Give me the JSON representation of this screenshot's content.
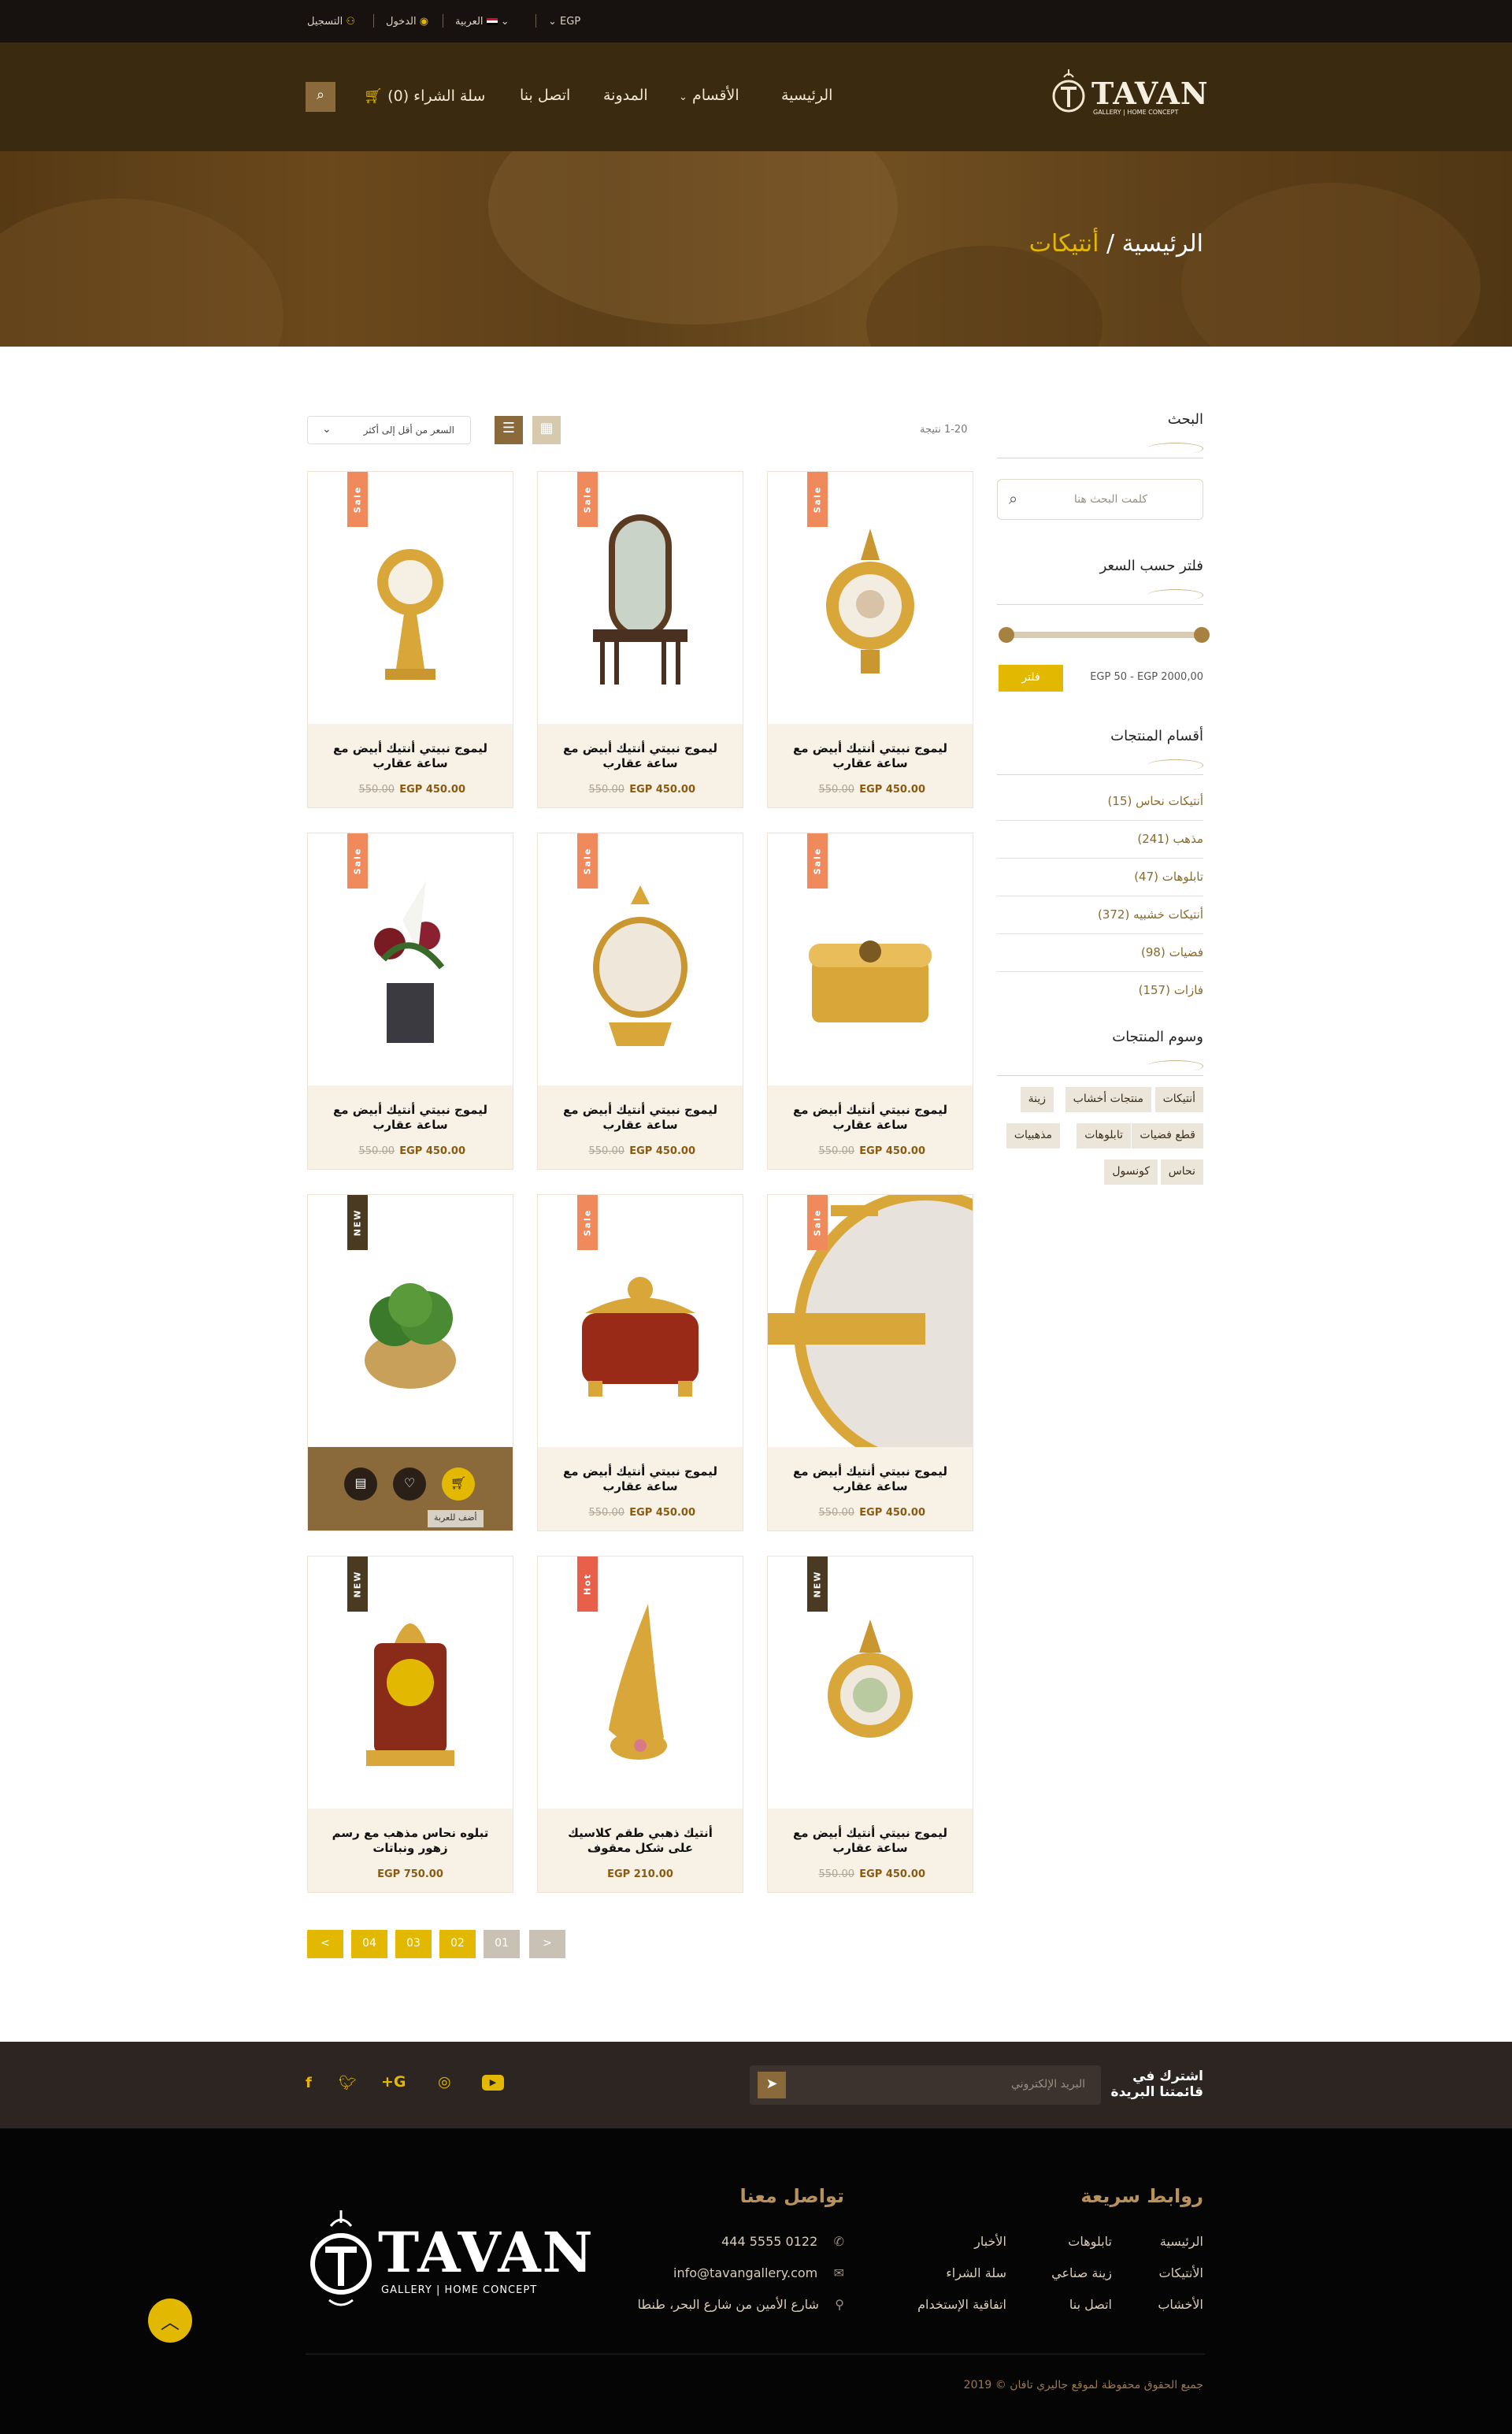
{
  "topbar": {
    "currency": "EGP",
    "language": "العربية",
    "login": "الدخول",
    "register": "التسجيل"
  },
  "brand": {
    "name": "TAVAN",
    "tagline": "GALLERY | HOME CONCEPT"
  },
  "nav": {
    "items": [
      "الرئيسية",
      "الأقسام",
      "المدونة",
      "اتصل بنا"
    ],
    "cart": "سلة الشراء (0)"
  },
  "breadcrumb": {
    "home": "الرئيسية /",
    "current": "أنتيكات"
  },
  "toolbar": {
    "results": "1-20 نتيجة",
    "sort": "السعر من أقل إلى أكثر"
  },
  "sidebar": {
    "search_title": "البحث",
    "search_placeholder": "كلمت البحث هنا",
    "price_title": "فلتر حسب السعر",
    "price_range": "EGP 50  -  EGP 2000,00",
    "filter_button": "فلتر",
    "price_min": 50,
    "price_max": 2000,
    "categories_title": "أقسام المنتجات",
    "categories": [
      "أنتيكات نحاس (15)",
      "مذهب (241)",
      "تابلوهات (47)",
      "أنتيكات خشبيه (372)",
      "فضيات (98)",
      "فازات (157)"
    ],
    "tags_title": "وسوم المنتجات",
    "tags": [
      "أنتيكات",
      "منتجات أخشاب",
      "زينة",
      "قطع فضيات",
      "تابلوهات",
      "مذهبيات",
      "نحاس",
      "كونسول"
    ]
  },
  "products": [
    {
      "name": "ليموج نبيتي أنتيك أبيض مع ساعة عقارب",
      "price": "EGP 450.00",
      "old": "550.00",
      "badge": "Sale"
    },
    {
      "name": "ليموج نبيتي أنتيك أبيض مع ساعة عقارب",
      "price": "EGP 450.00",
      "old": "550.00",
      "badge": "Sale"
    },
    {
      "name": "ليموج نبيتي أنتيك أبيض مع ساعة عقارب",
      "price": "EGP 450.00",
      "old": "550.00",
      "badge": "Sale"
    },
    {
      "name": "ليموج نبيتي أنتيك أبيض مع ساعة عقارب",
      "price": "EGP 450.00",
      "old": "550.00",
      "badge": "Sale"
    },
    {
      "name": "ليموج نبيتي أنتيك أبيض مع ساعة عقارب",
      "price": "EGP 450.00",
      "old": "550.00",
      "badge": "Sale"
    },
    {
      "name": "ليموج نبيتي أنتيك أبيض مع ساعة عقارب",
      "price": "EGP 450.00",
      "old": "550.00",
      "badge": "Sale"
    },
    {
      "name": "ليموج نبيتي أنتيك أبيض مع ساعة عقارب",
      "price": "EGP 450.00",
      "old": "550.00",
      "badge": "Sale"
    },
    {
      "name": "ليموج نبيتي أنتيك أبيض مع ساعة عقارب",
      "price": "EGP 450.00",
      "old": "550.00",
      "badge": "Sale"
    },
    {
      "name": "",
      "price": "",
      "old": "",
      "badge": "NEW",
      "hover_tooltip": "أضف للعربة"
    },
    {
      "name": "ليموج نبيتي أنتيك أبيض مع ساعة عقارب",
      "price": "EGP 450.00",
      "old": "550.00",
      "badge": "NEW"
    },
    {
      "name": "أنتيك ذهبي طقم كلاسيك على شكل معقوف",
      "price": "EGP 210.00",
      "old": "",
      "badge": "Hot"
    },
    {
      "name": "تبلوه نحاس مذهب مع رسم زهور ونباتات",
      "price": "EGP 750.00",
      "old": "",
      "badge": "NEW"
    }
  ],
  "pagination": [
    "<",
    "01",
    "02",
    "03",
    "04",
    ">"
  ],
  "newsletter": {
    "title_line1": "اشترك في",
    "title_line2": "قائمتنا البريدة",
    "placeholder": "البريد الإلكتروني"
  },
  "footer": {
    "quick_title": "روابط سريعة",
    "quick_links": [
      "الرئيسية",
      "تابلوهات",
      "الأخبار",
      "الأنتيكات",
      "زينة صناعي",
      "سلة الشراء",
      "الأخشاب",
      "اتصل بنا",
      "اتفاقية الإستخدام"
    ],
    "contact_title": "تواصل معنا",
    "phone": "0122 5555 444",
    "email": "info@tavangallery.com",
    "address": "شارع الأمين من شارع البحر، طنطا",
    "copyright": "جميع الحقوق محفوظة لموقع جاليري تافان © 2019"
  },
  "colors": {
    "accent": "#e3b800",
    "brown": "#3a2a0f",
    "sale": "#f08a5d",
    "hot": "#e8604a",
    "new": "#4a3a22"
  }
}
